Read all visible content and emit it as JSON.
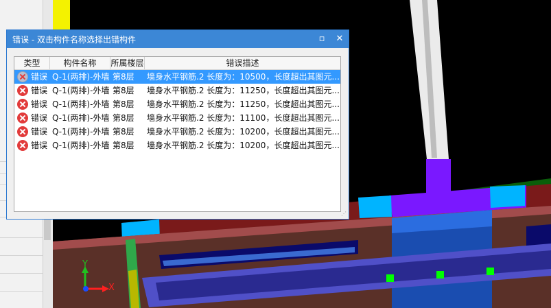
{
  "dialog": {
    "title": "错误 - 双击构件名称选择出错构件",
    "restore_glyph": "▫",
    "close_glyph": "✕",
    "columns": [
      "类型",
      "构件名称",
      "所属楼层",
      "错误描述"
    ],
    "rows": [
      {
        "type": "错误",
        "name": "Q-1(两排)-外墙",
        "floor": "第8层",
        "desc": "墙身水平钢筋.2 长度为：10500，长度超出其图元...",
        "selected": true
      },
      {
        "type": "错误",
        "name": "Q-1(两排)-外墙",
        "floor": "第8层",
        "desc": "墙身水平钢筋.2 长度为：11250，长度超出其图元...",
        "selected": false
      },
      {
        "type": "错误",
        "name": "Q-1(两排)-外墙",
        "floor": "第8层",
        "desc": "墙身水平钢筋.2 长度为：11250，长度超出其图元...",
        "selected": false
      },
      {
        "type": "错误",
        "name": "Q-1(两排)-外墙",
        "floor": "第8层",
        "desc": "墙身水平钢筋.2 长度为：11100，长度超出其图元...",
        "selected": false
      },
      {
        "type": "错误",
        "name": "Q-1(两排)-外墙",
        "floor": "第8层",
        "desc": "墙身水平钢筋.2 长度为：10200，长度超出其图元...",
        "selected": false
      },
      {
        "type": "错误",
        "name": "Q-1(两排)-外墙",
        "floor": "第8层",
        "desc": "墙身水平钢筋.2 长度为：10200，长度超出其图元...",
        "selected": false
      }
    ]
  },
  "axes": {
    "x_label": "X",
    "y_label": "Y",
    "x_color": "#ff2020",
    "y_color": "#20c020"
  }
}
